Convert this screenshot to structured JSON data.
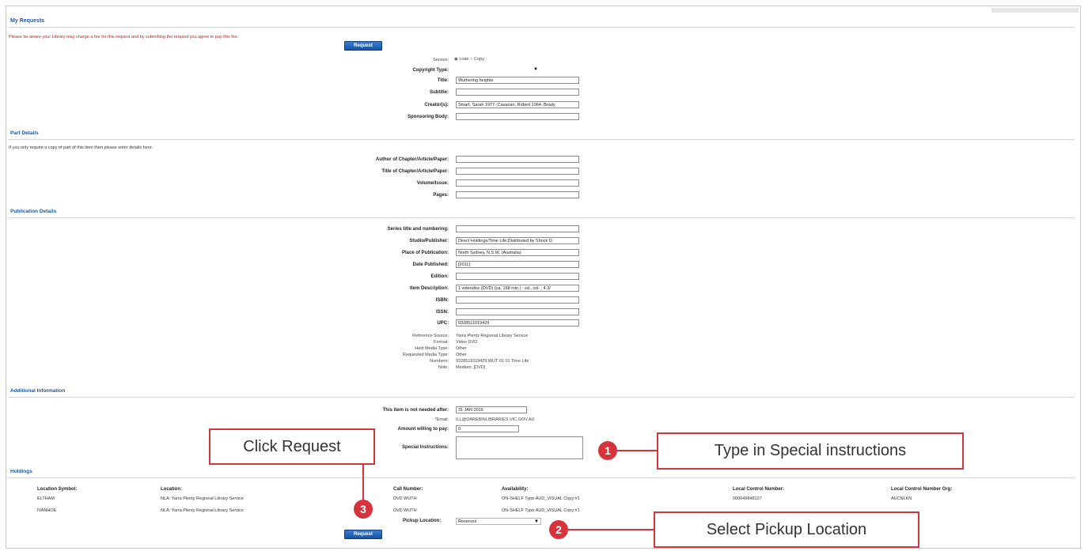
{
  "page": {
    "title": "My Requests",
    "fee_notice": "Please be aware your Library may charge a fee for this request and by submitting the request you agree to pay this fee.",
    "request_button": "Request"
  },
  "service": {
    "label": "Service:",
    "loan_label": "Loan",
    "copy_label": "Copy",
    "selected": "Loan"
  },
  "request_fields": [
    {
      "label": "Copyright Type:",
      "value": "",
      "type": "select"
    },
    {
      "label": "Title:",
      "value": "Wuthering heights",
      "type": "text"
    },
    {
      "label": "Subtitle:",
      "value": "",
      "type": "text"
    },
    {
      "label": "Creator(s):",
      "value": "Smart, Sarah 1977-;Cavanan, Robert 1964-;Brady",
      "type": "text"
    },
    {
      "label": "Sponsoring Body:",
      "value": "",
      "type": "text"
    }
  ],
  "part_details": {
    "heading": "Part Details",
    "note": "If you only require a copy of part of this item then please enter details here.",
    "fields": [
      {
        "label": "Author of Chapter/Article/Paper:",
        "value": ""
      },
      {
        "label": "Title of Chapter/Article/Paper:",
        "value": ""
      },
      {
        "label": "Volume/Issue:",
        "value": ""
      },
      {
        "label": "Pages:",
        "value": ""
      }
    ]
  },
  "publication_details": {
    "heading": "Publication Details",
    "fields": [
      {
        "label": "Series title and numbering:",
        "value": ""
      },
      {
        "label": "Studio/Publisher:",
        "value": "Direct Holdings/Time Life;Distributed by Shock D"
      },
      {
        "label": "Place of Publication:",
        "value": "North Sydney, N.S.W. (Australia)"
      },
      {
        "label": "Date Published:",
        "value": "[2011]"
      },
      {
        "label": "Edition:",
        "value": ""
      },
      {
        "label": "Item Description:",
        "value": "1 videodisc (DVD) (ca. 168 min.) : sd., col. ; 4 3/"
      },
      {
        "label": "ISBN:",
        "value": ""
      },
      {
        "label": "ISSN:",
        "value": ""
      },
      {
        "label": "UPC:",
        "value": "9328511019429"
      }
    ],
    "info": [
      {
        "label": "Reference Source:",
        "value": "Yarra Plenty Regional Library Service"
      },
      {
        "label": "Format:",
        "value": "Video DVD"
      },
      {
        "label": "Held Media Type:",
        "value": "Other"
      },
      {
        "label": "Requested Media Type:",
        "value": "Other"
      },
      {
        "label": "Numbers:",
        "value": "9328511019429;WUT 01 01 Time Life"
      },
      {
        "label": "Note:",
        "value": "Medium: [DVD]"
      }
    ]
  },
  "additional_information": {
    "heading": "Additional Information",
    "not_needed_label": "This item is not needed after:",
    "not_needed_value": "31 JAN 2016",
    "email_label": "*Email:",
    "email_value": "ILL@DAREBINLIBRARIES.VIC.GOV.AU",
    "amount_label": "Amount willing to pay:",
    "amount_value": "0",
    "special_label": "Special Instructions:",
    "special_value": ""
  },
  "holdings": {
    "heading": "Holdings",
    "columns": [
      "Location Symbol:",
      "Location:",
      "Call Number:",
      "Availability:",
      "Local Control Number:",
      "Local Control Number Org:"
    ],
    "rows": [
      [
        "ELTHAM",
        "NLA: Yarra Plenty Regional Library Service",
        "DVD WUTH",
        "ON-SHELF Type:AUD_VISUAL Copy:#1",
        "000049848127",
        "AUCNLKN"
      ],
      [
        "IVANHOE",
        "NLA: Yarra Plenty Regional Library Service",
        "DVD WUTH",
        "ON-SHELF Type:AUD_VISUAL Copy:#1",
        "",
        ""
      ]
    ],
    "pickup_label": "Pickup Location:",
    "pickup_value": "Reservoir"
  },
  "callouts": {
    "click_request": "Click Request",
    "special_instructions": "Type in Special instructions",
    "pickup_location": "Select Pickup Location",
    "badge_1": "1",
    "badge_2": "2",
    "badge_3": "3"
  },
  "colors": {
    "heading_blue": "#1c59a7",
    "notice_red": "#d21b1b",
    "callout_red": "#d7333d",
    "button_blue": "#1653a6"
  }
}
